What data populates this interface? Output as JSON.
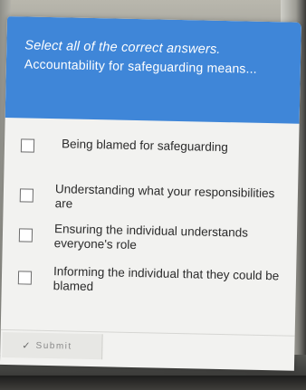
{
  "quiz": {
    "instruction": "Select all of the correct answers.",
    "question": "Accountability for safeguarding means...",
    "options": [
      {
        "label": "Being blamed for safeguarding",
        "checked": false
      },
      {
        "label": "Understanding what your responsibilities are",
        "checked": false
      },
      {
        "label": "Ensuring the individual understands everyone's role",
        "checked": false
      },
      {
        "label": "Informing the individual that they could be blamed",
        "checked": false
      }
    ],
    "submit_label": "Submit",
    "submit_icon": "check-icon"
  },
  "colors": {
    "header_background": "#3f86d8",
    "header_text": "#ffffff",
    "card_background": "#f2f2f0",
    "option_text": "#2b2b2b"
  }
}
